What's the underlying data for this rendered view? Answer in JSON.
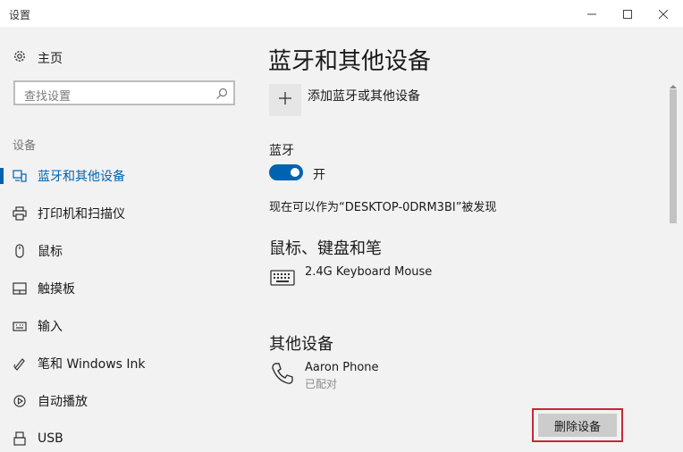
{
  "window": {
    "title": "设置",
    "minimize_icon": "minimize-icon",
    "maximize_icon": "maximize-icon",
    "close_icon": "close-icon"
  },
  "sidebar": {
    "home_label": "主页",
    "search_placeholder": "查找设置",
    "section_label": "设备",
    "items": [
      {
        "label": "蓝牙和其他设备",
        "icon": "bluetooth-devices-icon",
        "active": true
      },
      {
        "label": "打印机和扫描仪",
        "icon": "printer-icon",
        "active": false
      },
      {
        "label": "鼠标",
        "icon": "mouse-icon",
        "active": false
      },
      {
        "label": "触摸板",
        "icon": "touchpad-icon",
        "active": false
      },
      {
        "label": "输入",
        "icon": "keyboard-input-icon",
        "active": false
      },
      {
        "label": "笔和 Windows Ink",
        "icon": "pen-icon",
        "active": false
      },
      {
        "label": "自动播放",
        "icon": "autoplay-icon",
        "active": false
      },
      {
        "label": "USB",
        "icon": "usb-icon",
        "active": false
      }
    ]
  },
  "main": {
    "title": "蓝牙和其他设备",
    "add_device_label": "添加蓝牙或其他设备",
    "bluetooth_label": "蓝牙",
    "bluetooth_state": "开",
    "discoverable_text": "现在可以作为“DESKTOP-0DRM3BI”被发现",
    "mouse_keyboard_heading": "鼠标、键盘和笔",
    "keyboard_device": "2.4G Keyboard Mouse",
    "other_heading": "其他设备",
    "phone_name": "Aaron Phone",
    "phone_status": "已配对",
    "remove_button": "删除设备"
  },
  "colors": {
    "accent": "#0063b1",
    "highlight_border": "#c62836",
    "background": "#f2f2f2"
  }
}
